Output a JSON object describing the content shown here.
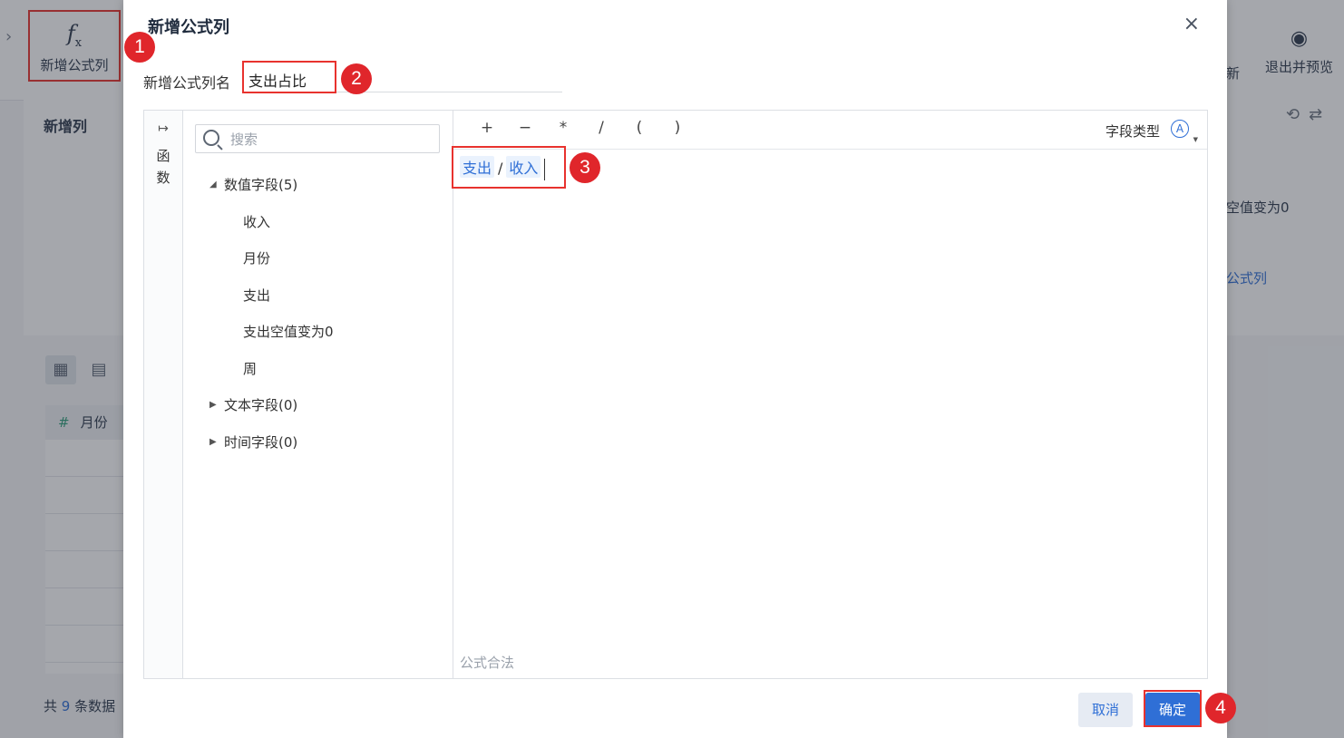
{
  "background": {
    "sidebar_chevron": "›",
    "add_formula_label": "新增公式列",
    "exit_preview_label": "退出并预览",
    "partial_new_label": "新",
    "new_column_title": "新增列",
    "right_panel_text1": "空值变为0",
    "right_panel_text2": "公式列",
    "table_header_icon": "#",
    "table_header_label": "月份",
    "count_prefix": "共",
    "count_value": "9",
    "count_suffix": "条数据"
  },
  "dialog": {
    "title": "新增公式列",
    "close_label": "×",
    "name_label": "新增公式列名",
    "name_value": "支出占比",
    "function_toggle": "↦",
    "function_label": "函数",
    "search_placeholder": "搜索",
    "field_groups": [
      {
        "label": "数值字段(5)",
        "expanded": true,
        "items": [
          "收入",
          "月份",
          "支出",
          "支出空值变为0",
          "周"
        ]
      },
      {
        "label": "文本字段(0)",
        "expanded": false,
        "items": []
      },
      {
        "label": "时间字段(0)",
        "expanded": false,
        "items": []
      }
    ],
    "operators": [
      "+",
      "−",
      "*",
      "/",
      "(",
      ")"
    ],
    "field_type_label": "字段类型",
    "field_type_icon": "A",
    "formula_tokens": {
      "field1": "支出",
      "operator": "/",
      "field2": "收入"
    },
    "validation_message": "公式合法",
    "cancel_label": "取消",
    "confirm_label": "确定"
  },
  "markers": [
    "1",
    "2",
    "3",
    "4"
  ]
}
